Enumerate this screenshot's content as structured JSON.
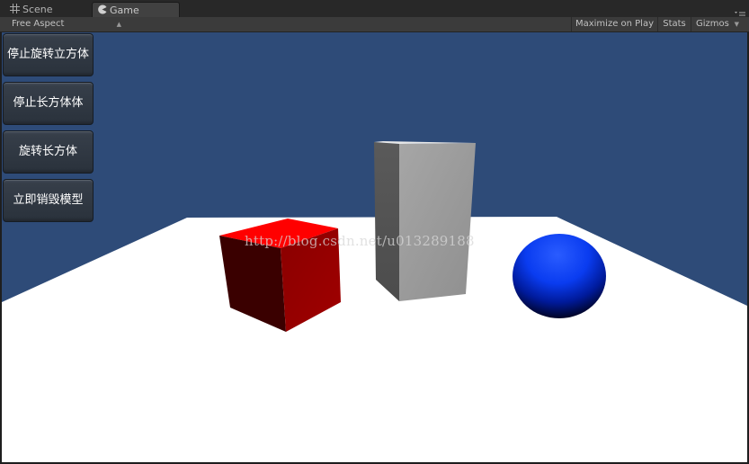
{
  "tabs": [
    {
      "label": "Scene",
      "icon": "grid-icon"
    },
    {
      "label": "Game",
      "icon": "pacman-icon"
    }
  ],
  "toolbar": {
    "aspect_label": "Free Aspect",
    "maximize_label": "Maximize on Play",
    "stats_label": "Stats",
    "gizmos_label": "Gizmos"
  },
  "gui_buttons": [
    {
      "label": "停止旋转立方体"
    },
    {
      "label": "停止长方体体"
    },
    {
      "label": "旋转长方体"
    },
    {
      "label": "立即销毁模型"
    }
  ],
  "watermark": "http://blog.csdn.net/u013289188",
  "colors": {
    "sky": "#2e4b78",
    "ground": "#ffffff",
    "cube_red": "#ff0000",
    "box_gray": "#9a9a9a",
    "sphere_blue": "#0044ff",
    "button_text": "#ffffff"
  }
}
